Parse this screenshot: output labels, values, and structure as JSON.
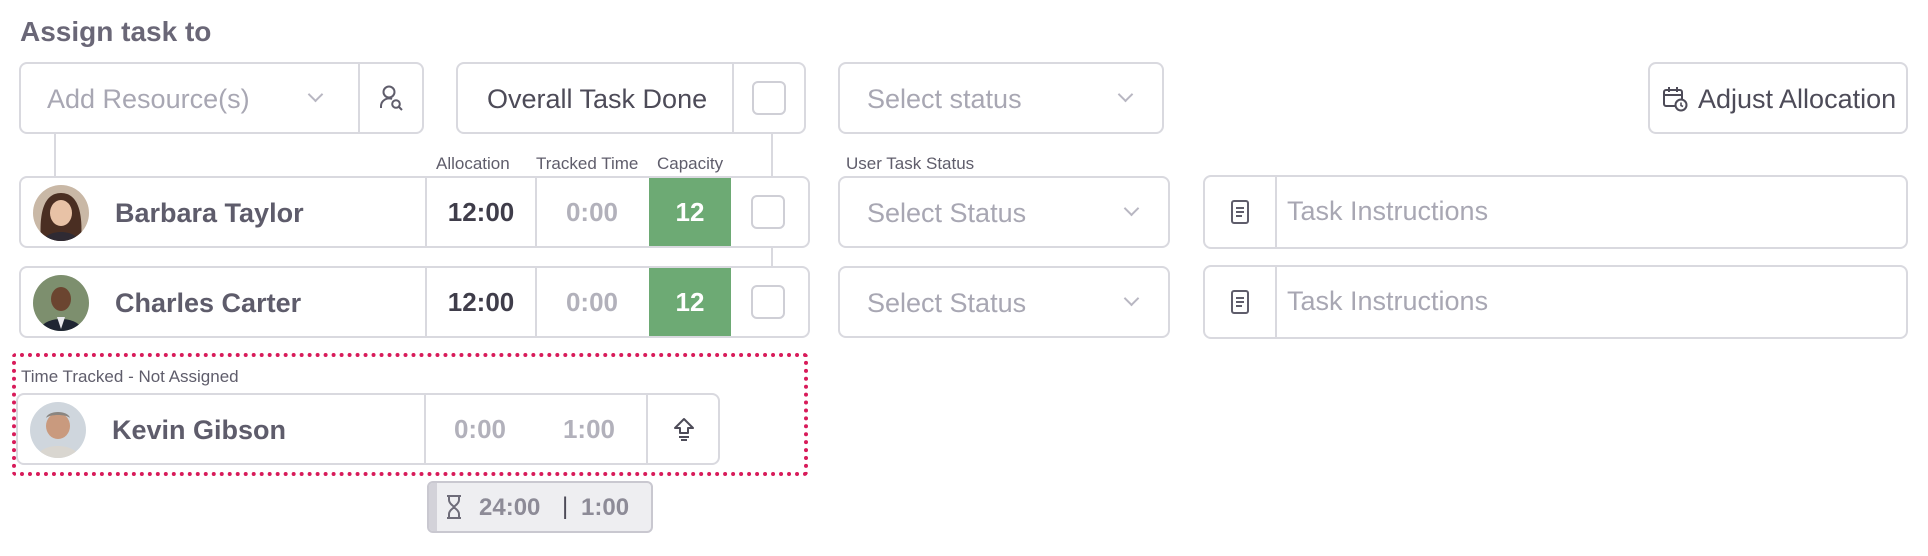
{
  "section_title": "Assign task to",
  "add_resource": {
    "placeholder": "Add Resource(s)",
    "search_icon": "person-search-icon"
  },
  "overall_task_done": {
    "label": "Overall Task Done"
  },
  "status_select": {
    "placeholder": "Select status"
  },
  "adjust_allocation": {
    "label": "Adjust Allocation",
    "icon": "calendar-clock-icon"
  },
  "columns": {
    "allocation": "Allocation",
    "tracked_time": "Tracked Time",
    "capacity": "Capacity",
    "user_task_status": "User Task Status"
  },
  "assignees": [
    {
      "name": "Barbara Taylor",
      "allocation": "12:00",
      "tracked": "0:00",
      "capacity": "12",
      "status_placeholder": "Select Status",
      "instructions_placeholder": "Task Instructions"
    },
    {
      "name": "Charles Carter",
      "allocation": "12:00",
      "tracked": "0:00",
      "capacity": "12",
      "status_placeholder": "Select Status",
      "instructions_placeholder": "Task Instructions"
    }
  ],
  "unassigned": {
    "label": "Time Tracked - Not Assigned",
    "name": "Kevin Gibson",
    "allocation": "0:00",
    "tracked": "1:00",
    "action_icon": "assign-up-arrow-icon"
  },
  "totals": {
    "allocation": "24:00",
    "separator": "|",
    "tracked": "1:00",
    "icon": "hourglass-icon"
  },
  "colors": {
    "capacity_green": "#6daa74",
    "unassigned_border": "#d81b5a"
  }
}
